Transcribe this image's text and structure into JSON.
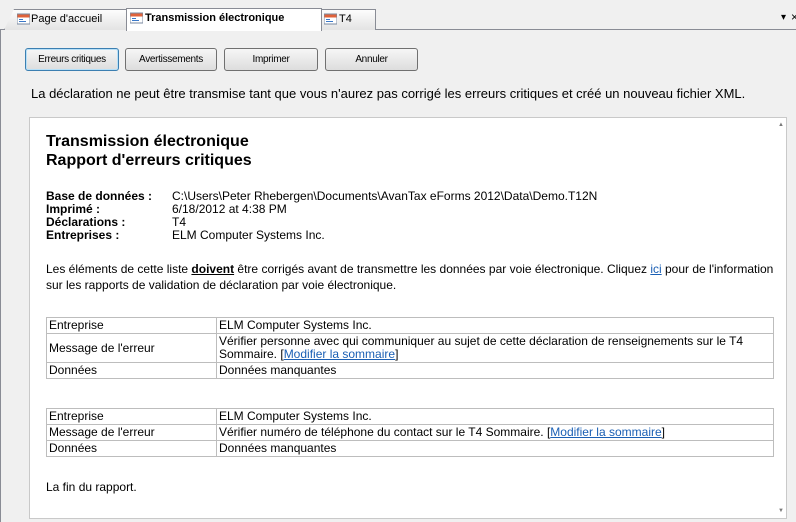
{
  "tabs": [
    {
      "label": "Page d'accueil"
    },
    {
      "label": "Transmission électronique"
    },
    {
      "label": "T4"
    }
  ],
  "tabstrip": {
    "dropdown_glyph": "▾",
    "close_glyph": "×"
  },
  "buttons": {
    "critical": "Erreurs critiques",
    "warnings": "Avertissements",
    "print": "Imprimer",
    "cancel": "Annuler"
  },
  "notice": "La déclaration ne peut être transmise tant que vous n'aurez pas corrigé les erreurs critiques et créé un nouveau fichier XML.",
  "report": {
    "title": "Transmission électronique",
    "subtitle": "Rapport d'erreurs critiques",
    "meta": [
      {
        "key": "Base de données :",
        "value": "C:\\Users\\Peter Rhebergen\\Documents\\AvanTax eForms 2012\\Data\\Demo.T12N"
      },
      {
        "key": "Imprimé :",
        "value": "6/18/2012 at 4:38 PM"
      },
      {
        "key": "Déclarations :",
        "value": "T4"
      },
      {
        "key": "Entreprises :",
        "value": "ELM Computer Systems Inc."
      }
    ],
    "intro_before": "Les éléments de cette liste ",
    "intro_bold": "doivent",
    "intro_mid": " être corrigés avant de transmettre les données par voie électronique. Cliquez ",
    "intro_link": "ici",
    "intro_after": " pour de l'information sur les rapports de validation de déclaration par voie électronique.",
    "errors": [
      {
        "company_label": "Entreprise",
        "company": "ELM Computer Systems Inc.",
        "message_label": "Message de l'erreur",
        "message": "Vérifier personne avec qui communiquer au sujet de cette déclaration de renseignements sur le T4 Sommaire. [",
        "message_link": "Modifier la sommaire",
        "message_end": "]",
        "data_label": "Données",
        "data": "Données manquantes"
      },
      {
        "company_label": "Entreprise",
        "company": "ELM Computer Systems Inc.",
        "message_label": "Message de l'erreur",
        "message": "Vérifier numéro de téléphone du contact sur le T4 Sommaire. [",
        "message_link": "Modifier la sommaire",
        "message_end": "]",
        "data_label": "Données",
        "data": "Données manquantes"
      }
    ],
    "end": "La fin du rapport."
  },
  "colors": {
    "link": "#1a5fb4",
    "tab_icon_red": "#e0623a",
    "tab_icon_blue": "#3a78c8"
  },
  "icons": {
    "tab_icon": "form-icon",
    "scroll_up": "▲",
    "scroll_down": "▼"
  }
}
